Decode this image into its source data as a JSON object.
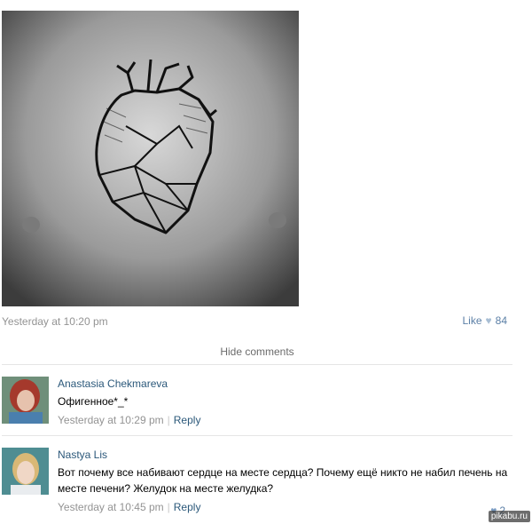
{
  "post": {
    "date": "Yesterday at 10:20 pm",
    "like_label": "Like",
    "like_count": "84",
    "hide_comments_label": "Hide comments"
  },
  "comments": [
    {
      "author": "Anastasia Chekmareva",
      "text": "Офигенное*_*",
      "date": "Yesterday at 10:29 pm",
      "reply_label": "Reply"
    },
    {
      "author": "Nastya Lis",
      "text": "Вот почему все набивают сердце на месте сердца? Почему ещё никто не набил печень на месте печени? Желудок на месте желудка?",
      "date": "Yesterday at 10:45 pm",
      "reply_label": "Reply",
      "likes": "2"
    }
  ],
  "watermark": "pikabu.ru",
  "icons": {
    "like": "heart-icon",
    "photo": "heart-tattoo-photo"
  },
  "colors": {
    "link": "#2b587a",
    "muted": "#939393",
    "like": "#5b7fa6"
  }
}
